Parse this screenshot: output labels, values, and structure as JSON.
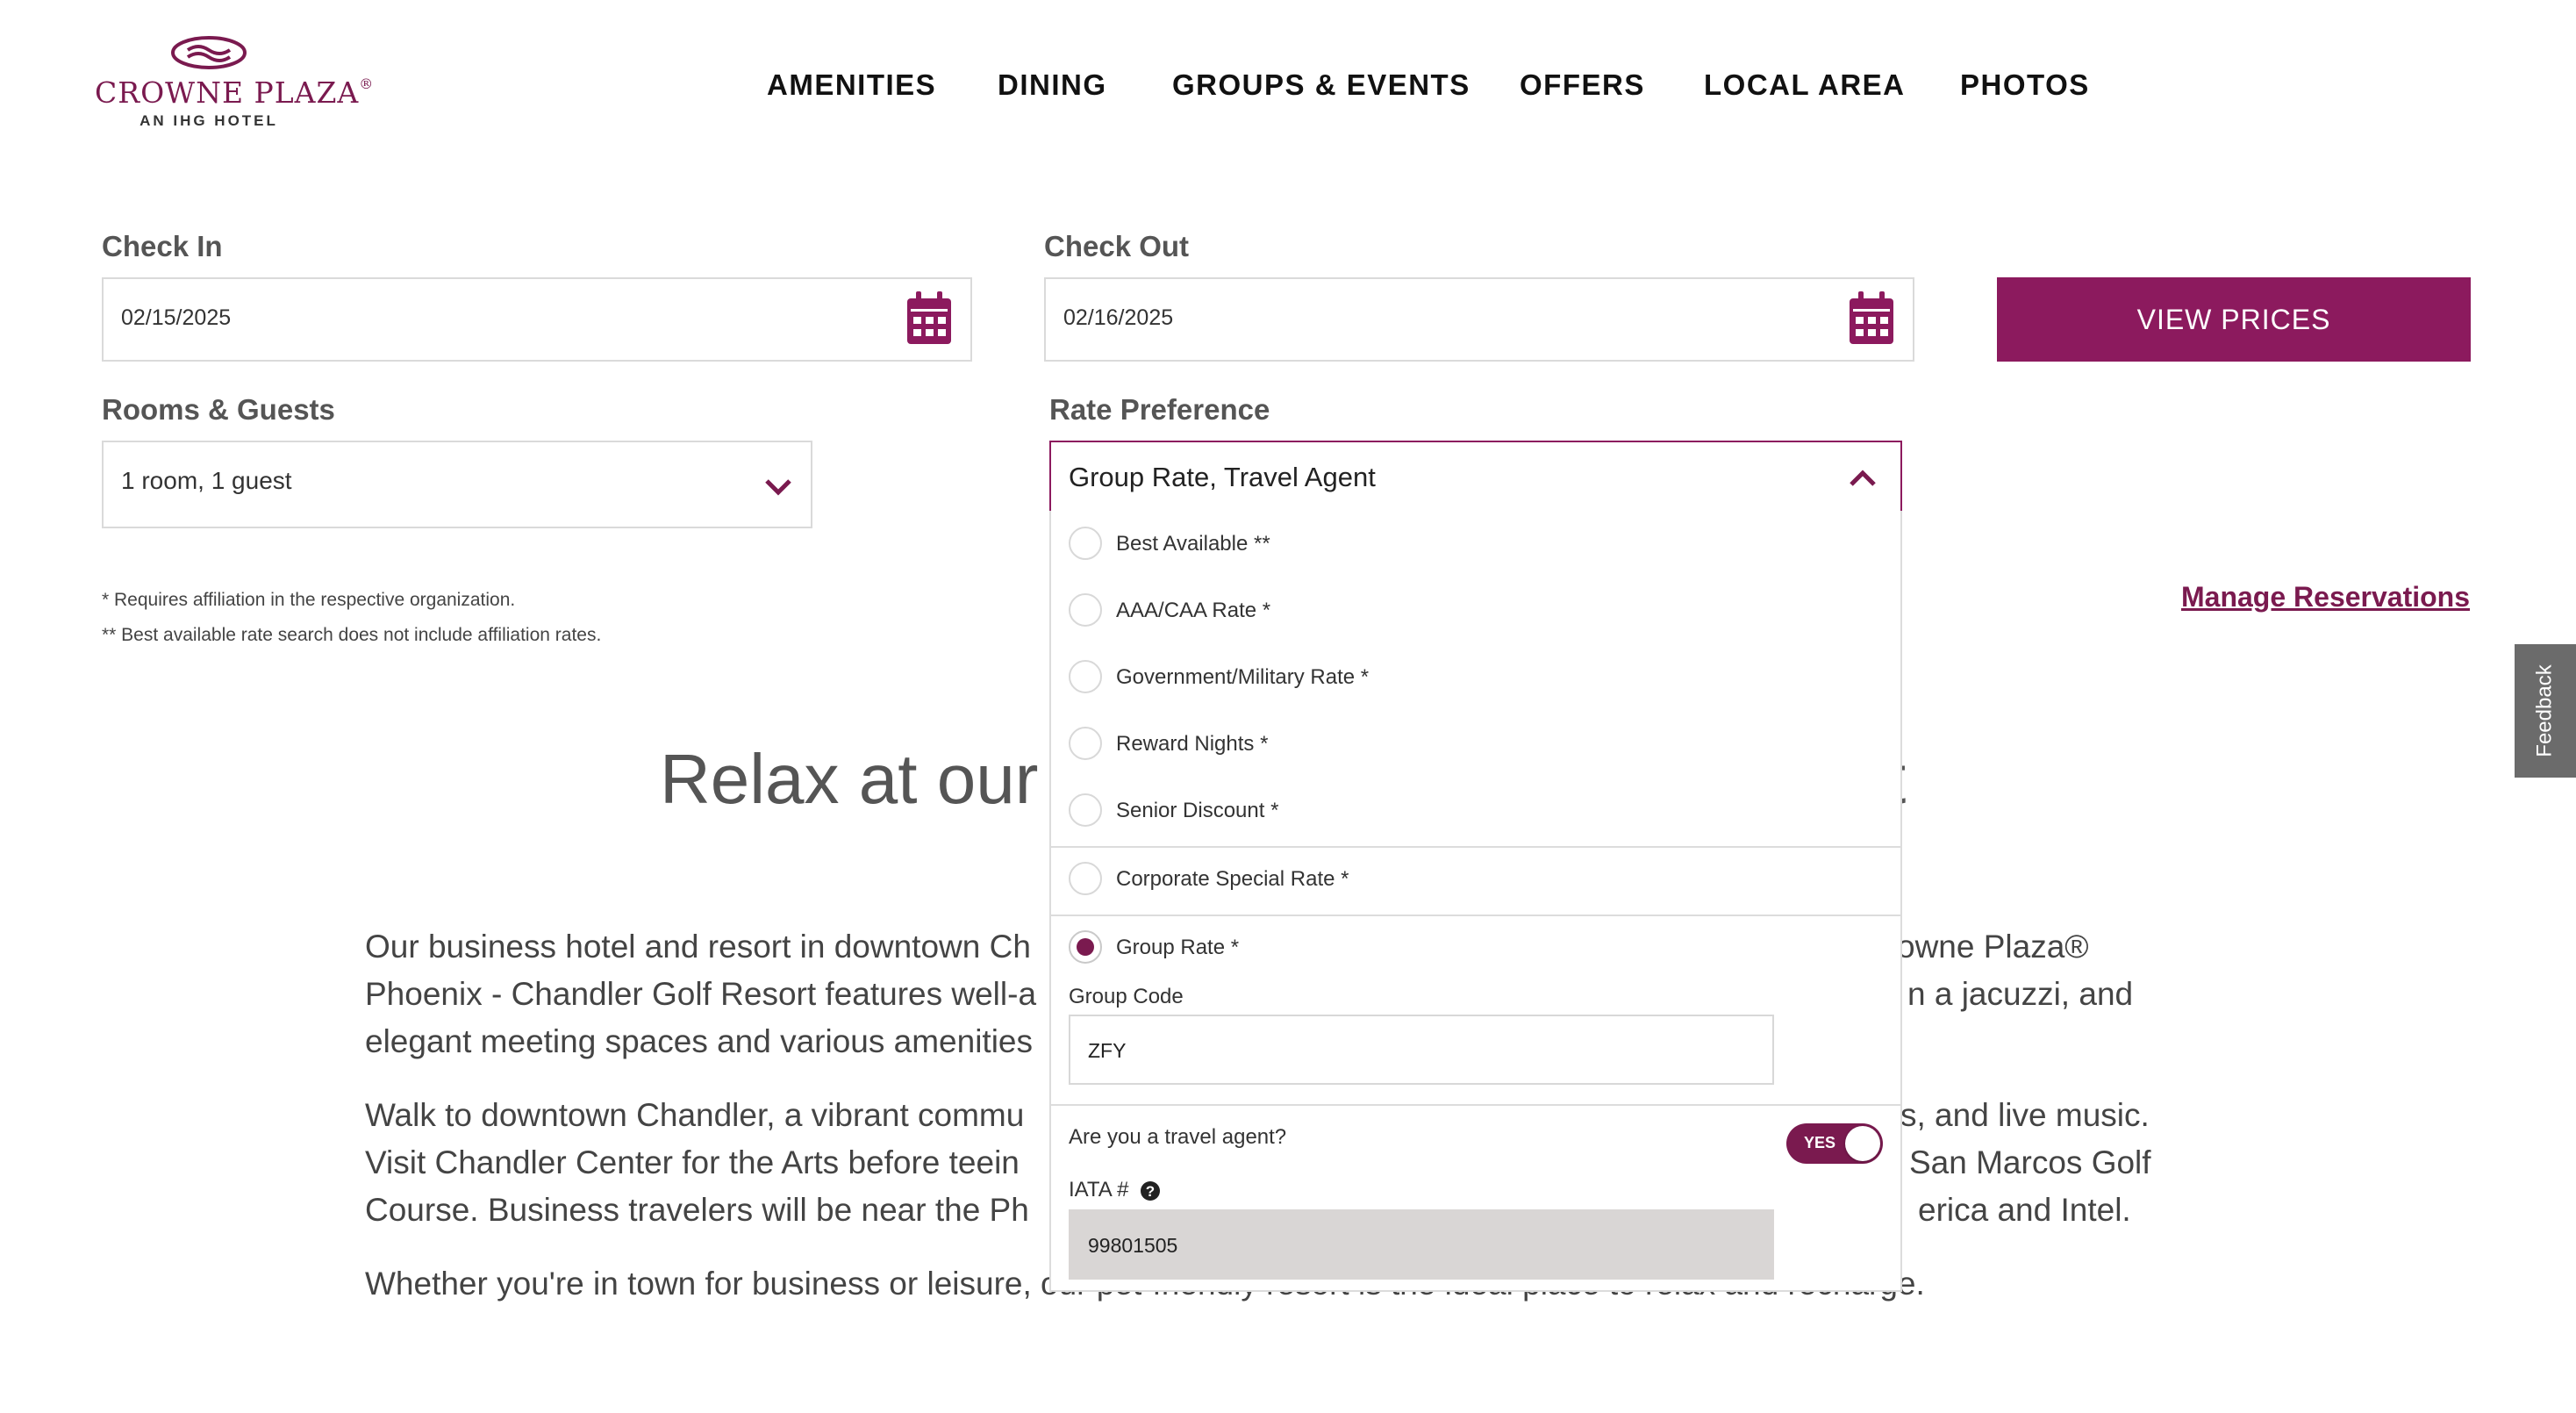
{
  "brand": {
    "name": "CROWNE PLAZA",
    "registered": "®",
    "subtitle": "AN IHG HOTEL",
    "color": "#7a1a4f"
  },
  "nav": {
    "items": [
      "AMENITIES",
      "DINING",
      "GROUPS & EVENTS",
      "OFFERS",
      "LOCAL AREA",
      "PHOTOS"
    ]
  },
  "booking": {
    "check_in": {
      "label": "Check In",
      "value": "02/15/2025",
      "icon": "calendar-icon"
    },
    "check_out": {
      "label": "Check Out",
      "value": "02/16/2025",
      "icon": "calendar-icon"
    },
    "view_prices": "VIEW PRICES",
    "rooms_guests": {
      "label": "Rooms & Guests",
      "value": "1 room, 1 guest",
      "icon": "chevron-down-icon"
    },
    "rate_preference": {
      "label": "Rate Preference",
      "selected": "Group Rate, Travel Agent",
      "icon": "chevron-up-icon",
      "options": [
        {
          "label": "Best Available **",
          "checked": false
        },
        {
          "label": "AAA/CAA Rate *",
          "checked": false
        },
        {
          "label": "Government/Military Rate *",
          "checked": false
        },
        {
          "label": "Reward Nights *",
          "checked": false
        },
        {
          "label": "Senior Discount *",
          "checked": false
        },
        {
          "label": "Corporate Special Rate *",
          "checked": false
        },
        {
          "label": "Group Rate *",
          "checked": true
        }
      ],
      "group_code": {
        "label": "Group Code",
        "value": "ZFY"
      },
      "travel_agent": {
        "question": "Are you a travel agent?",
        "toggle_label": "YES",
        "on": true
      },
      "iata": {
        "label": "IATA #",
        "value": "99801505",
        "icon": "help-icon"
      }
    },
    "footnotes": [
      "* Requires affiliation in the respective organization.",
      "** Best available rate search does not include affiliation rates."
    ],
    "manage_reservations": "Manage Reservations"
  },
  "feedback": "Feedback",
  "content": {
    "headline_visible": "Relax at our",
    "headline_tail": "t",
    "paragraph1": [
      {
        "left": "Our business hotel and resort in downtown Ch",
        "right": "owne Plaza®"
      },
      {
        "left": "Phoenix - Chandler Golf Resort features well-a",
        "right": "n a jacuzzi, and"
      },
      {
        "left": "elegant meeting spaces and various amenities",
        "right": ""
      }
    ],
    "paragraph2": [
      {
        "left": "Walk to downtown Chandler, a vibrant commu",
        "right": "s, and live music."
      },
      {
        "left": "Visit Chandler Center for the Arts before teein",
        "right": "San Marcos Golf"
      },
      {
        "left": "Course. Business travelers will be near the Ph",
        "right": "erica and Intel."
      }
    ],
    "paragraph3": "Whether you're in town for business or leisure, our pet-friendly resort is the ideal place to relax and recharge."
  }
}
